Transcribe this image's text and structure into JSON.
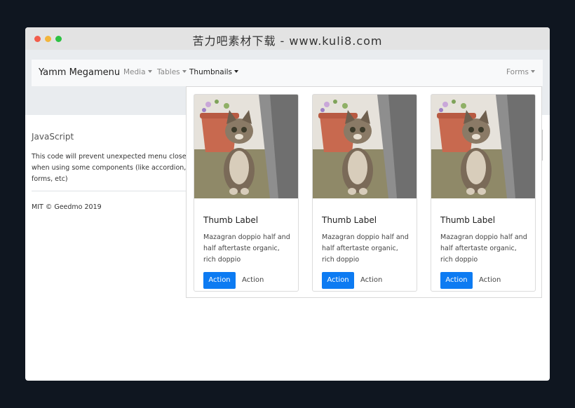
{
  "window": {
    "title": "苦力吧素材下载 - www.kuli8.com"
  },
  "navbar": {
    "brand": "Yamm Megamenu",
    "links": [
      {
        "label": "Media",
        "active": false
      },
      {
        "label": "Tables",
        "active": false
      },
      {
        "label": "Thumbnails",
        "active": true
      }
    ],
    "right_link": "Forms"
  },
  "sidebar": {
    "title": "JavaScript",
    "text": "This code will prevent unexpected menu close when using some components (like accordion, forms, etc)",
    "footer": "MIT © Geedmo 2019"
  },
  "thumbnails": {
    "cards": [
      {
        "title": "Thumb Label",
        "text": "Mazagran doppio half and half aftertaste organic, rich doppio",
        "primary_action": "Action",
        "secondary_action": "Action"
      },
      {
        "title": "Thumb Label",
        "text": "Mazagran doppio half and half aftertaste organic, rich doppio",
        "primary_action": "Action",
        "secondary_action": "Action"
      },
      {
        "title": "Thumb Label",
        "text": "Mazagran doppio half and half aftertaste organic, rich doppio",
        "primary_action": "Action",
        "secondary_action": "Action"
      }
    ],
    "image_subject": "kitten-photo"
  },
  "colors": {
    "primary": "#0d7bf2",
    "navbar_bg": "#f8f9fa",
    "page_header_bg": "#e9ecef",
    "backdrop": "#0f1620"
  }
}
